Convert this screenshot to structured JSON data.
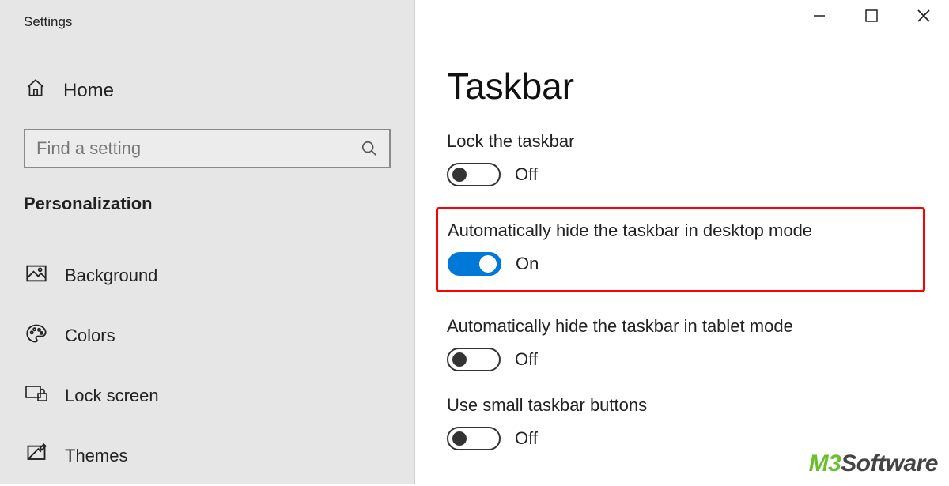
{
  "app_title": "Settings",
  "sidebar": {
    "home_label": "Home",
    "search_placeholder": "Find a setting",
    "section": "Personalization",
    "items": [
      {
        "label": "Background"
      },
      {
        "label": "Colors"
      },
      {
        "label": "Lock screen"
      },
      {
        "label": "Themes"
      }
    ]
  },
  "main": {
    "title": "Taskbar",
    "settings": [
      {
        "label": "Lock the taskbar",
        "state": "Off",
        "on": false
      },
      {
        "label": "Automatically hide the taskbar in desktop mode",
        "state": "On",
        "on": true,
        "highlighted": true
      },
      {
        "label": "Automatically hide the taskbar in tablet mode",
        "state": "Off",
        "on": false
      },
      {
        "label": "Use small taskbar buttons",
        "state": "Off",
        "on": false
      }
    ]
  },
  "watermark": {
    "brand1": "M3",
    "brand2": "Software"
  }
}
